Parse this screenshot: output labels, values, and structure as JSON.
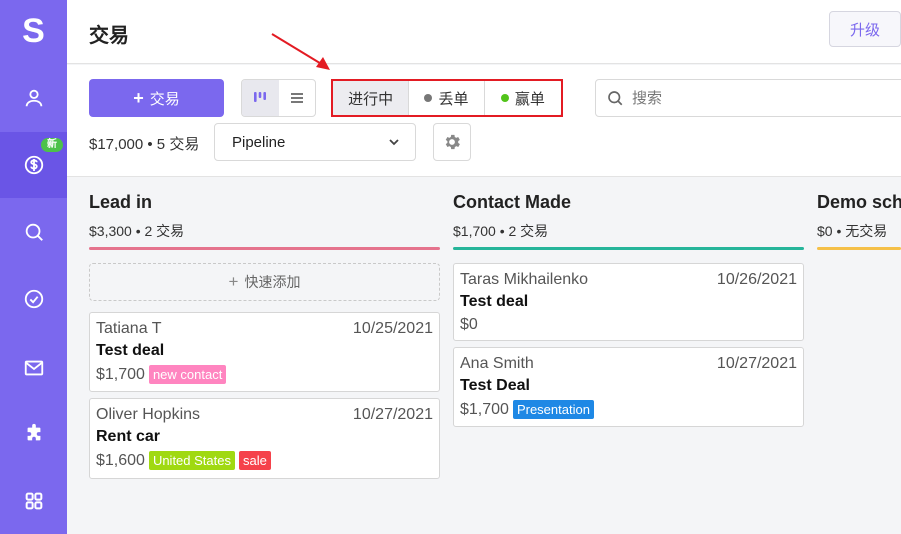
{
  "app": {
    "logo_letter": "S"
  },
  "sidebar": {
    "items": [
      {
        "icon": "user-icon"
      },
      {
        "icon": "dollar-icon",
        "badge": "新",
        "active": true
      },
      {
        "icon": "search-icon"
      },
      {
        "icon": "check-circle-icon"
      },
      {
        "icon": "mail-icon"
      },
      {
        "icon": "puzzle-icon"
      },
      {
        "icon": "apps-grid-icon"
      }
    ]
  },
  "header": {
    "title": "交易",
    "upgrade_label": "升级"
  },
  "toolbar": {
    "add_deal_label": "交易",
    "status_filters": [
      {
        "label": "进行中",
        "active": true
      },
      {
        "label": "丢单",
        "dot_color": "#777777"
      },
      {
        "label": "赢单",
        "dot_color": "#52c41a"
      }
    ],
    "search_placeholder": "搜索",
    "summary": "$17,000 • 5 交易",
    "pipeline_value": "Pipeline"
  },
  "colors": {
    "accent": "#7b68ee",
    "highlight": "#e31b23"
  },
  "board": {
    "quick_add_label": "快速添加",
    "columns": [
      {
        "title": "Lead in",
        "meta": "$3,300 • 2 交易",
        "bar_color": "#e5738d",
        "cards": [
          {
            "contact": "Tatiana T",
            "date": "10/25/2021",
            "deal": "Test deal",
            "amount": "$1,700",
            "tags": [
              {
                "label": "new contact",
                "color": "#ff85c0"
              }
            ]
          },
          {
            "contact": "Oliver Hopkins",
            "date": "10/27/2021",
            "deal": "Rent car",
            "amount": "$1,600",
            "tags": [
              {
                "label": "United States",
                "color": "#a0d911"
              },
              {
                "label": "sale",
                "color": "#f5424b"
              }
            ]
          }
        ]
      },
      {
        "title": "Contact Made",
        "meta": "$1,700 • 2 交易",
        "bar_color": "#26b59a",
        "cards": [
          {
            "contact": "Taras Mikhailenko",
            "date": "10/26/2021",
            "deal": "Test deal",
            "amount": "$0",
            "tags": []
          },
          {
            "contact": "Ana Smith",
            "date": "10/27/2021",
            "deal": "Test Deal",
            "amount": "$1,700",
            "tags": [
              {
                "label": "Presentation",
                "color": "#1e88e5"
              }
            ]
          }
        ]
      },
      {
        "title": "Demo sche",
        "meta": "$0 • 无交易",
        "bar_color": "#f5c048",
        "cards": []
      }
    ]
  }
}
